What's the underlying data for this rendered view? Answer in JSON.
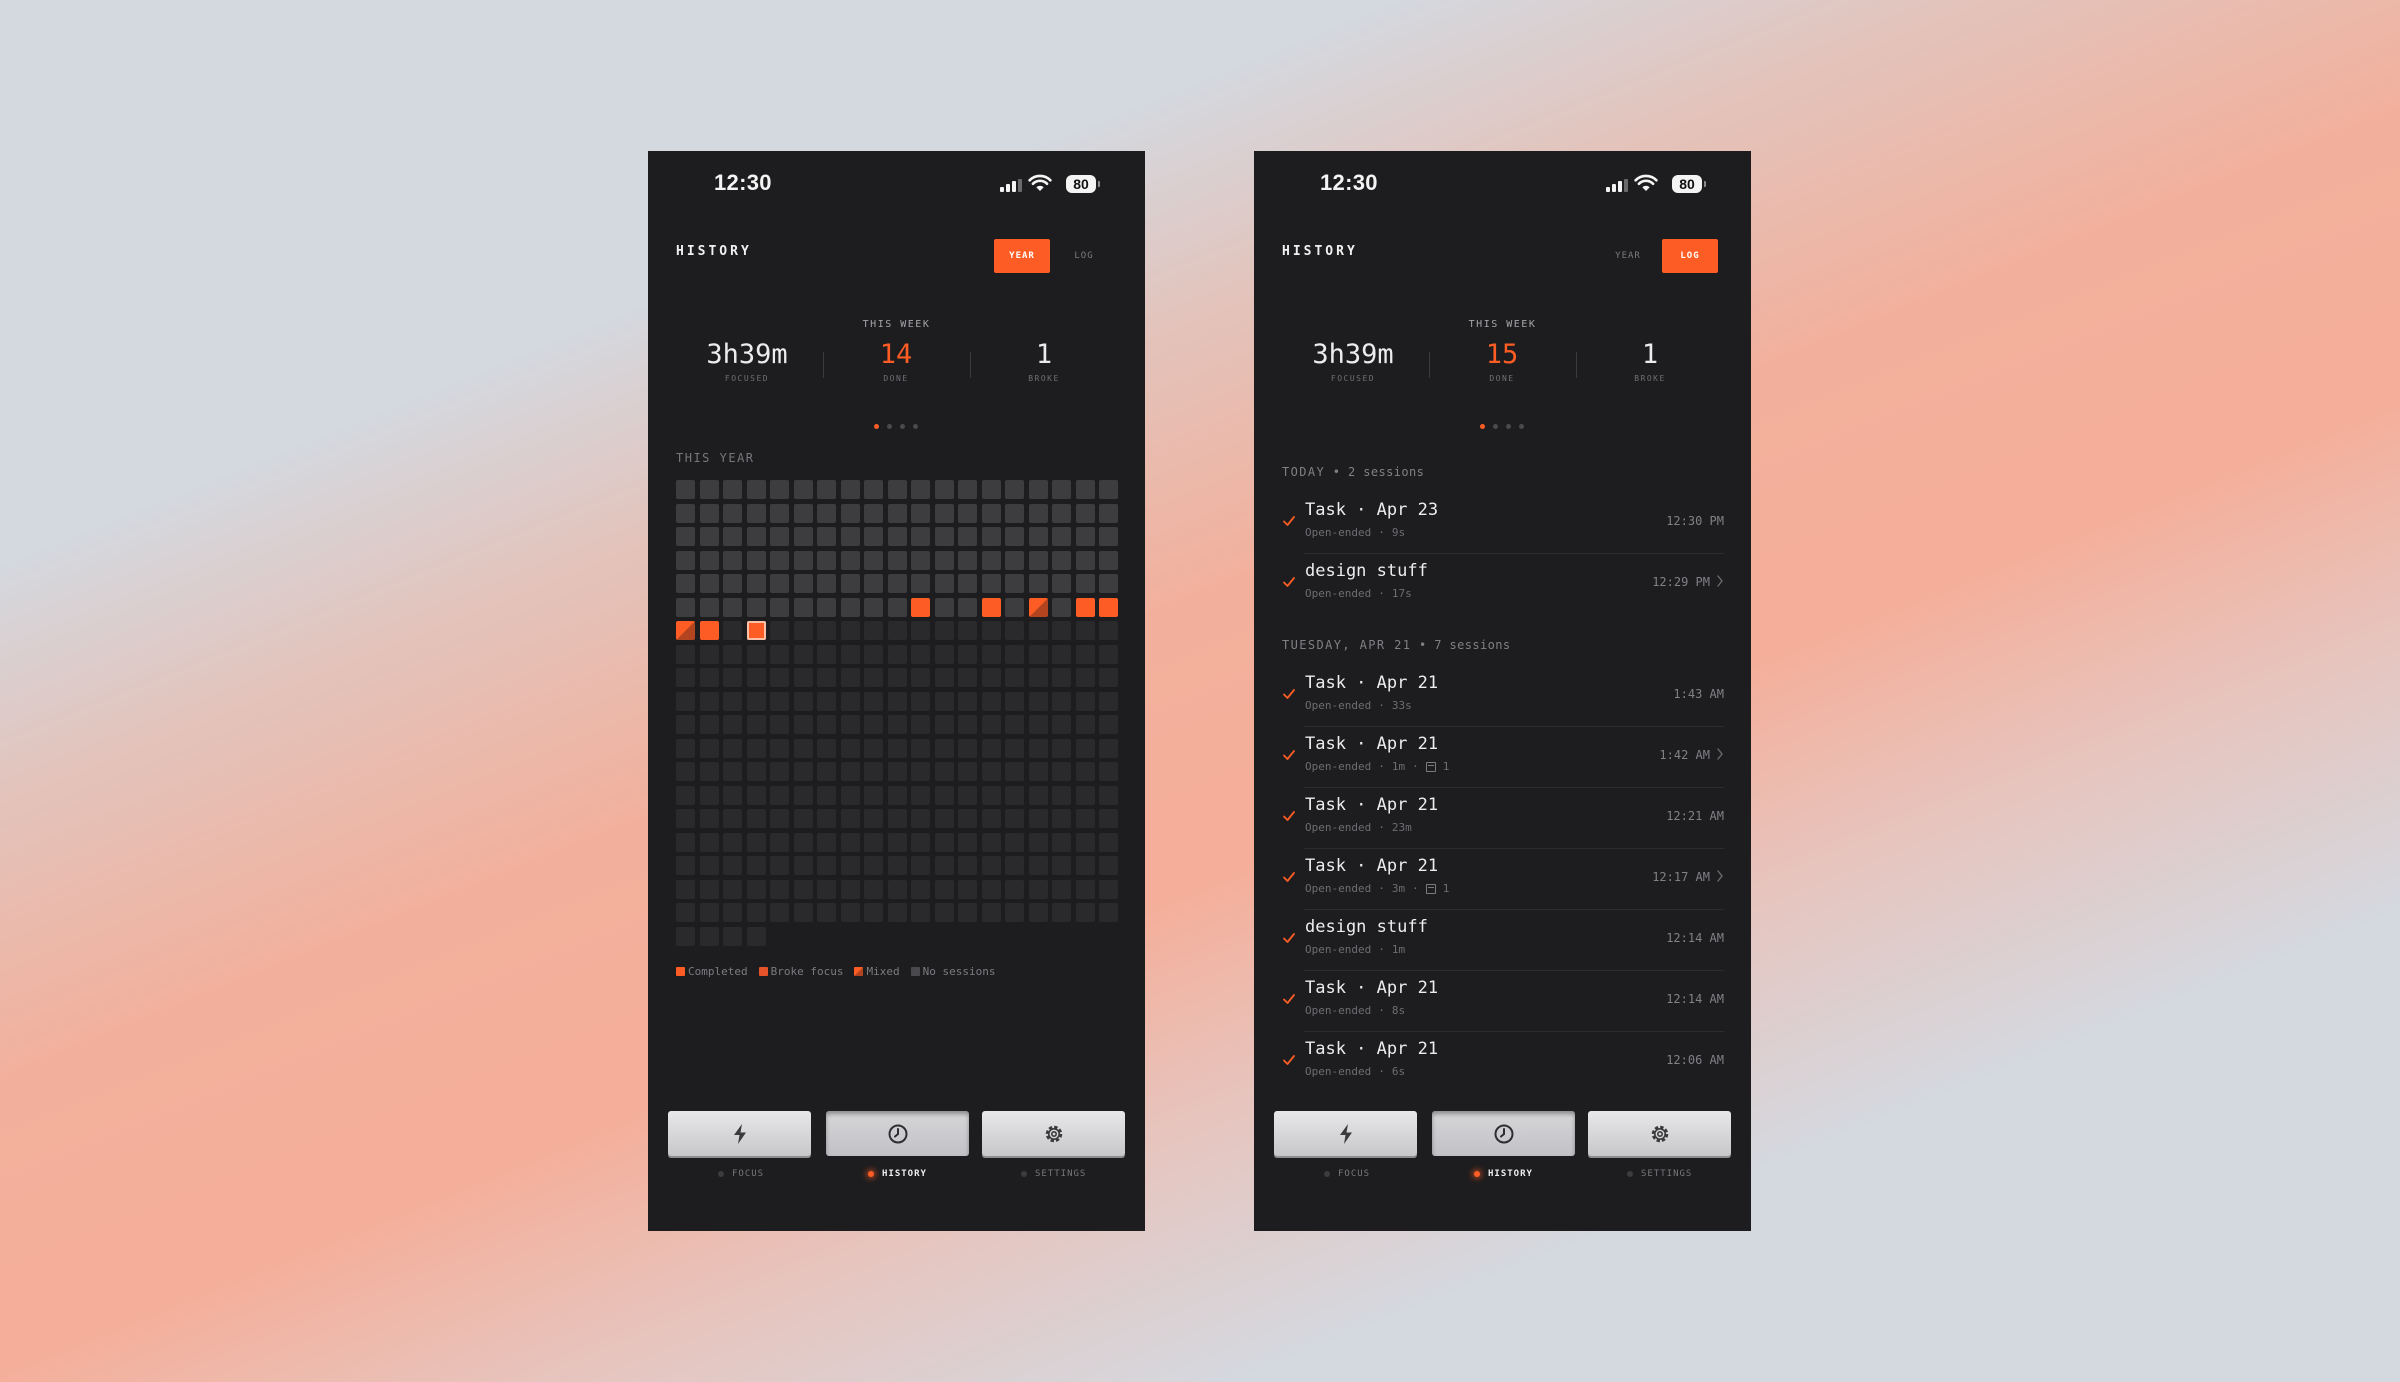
{
  "theme": {
    "accent": "#fd5d24",
    "screen_bg": "#1d1d1f"
  },
  "status": {
    "time": "12:30",
    "battery": "80"
  },
  "header": {
    "title": "HISTORY",
    "toggle_year": "YEAR",
    "toggle_log": "LOG"
  },
  "left": {
    "week_label": "THIS WEEK",
    "stats": [
      {
        "value": "3h39m",
        "label": "FOCUSED"
      },
      {
        "value": "14",
        "label": "DONE"
      },
      {
        "value": "1",
        "label": "BROKE"
      }
    ],
    "year_label": "THIS YEAR",
    "heatmap": {
      "weeks": 20,
      "days_per_week": 7,
      "total_days": 365,
      "past_days": 115,
      "completed_days": [
        105,
        108,
        112,
        113,
        115
      ],
      "mixed_days": [
        110,
        114
      ],
      "today": 117
    },
    "legend": [
      {
        "label": "Completed",
        "color": "#fd5d24"
      },
      {
        "label": "Broke focus",
        "color": "#e4532a"
      },
      {
        "label": "Mixed",
        "color": "#e65b2a"
      },
      {
        "label": "No sessions",
        "color": "#4a4a4e"
      }
    ]
  },
  "right": {
    "week_label": "THIS WEEK",
    "stats": [
      {
        "value": "3h39m",
        "label": "FOCUSED"
      },
      {
        "value": "15",
        "label": "DONE"
      },
      {
        "value": "1",
        "label": "BROKE"
      }
    ],
    "sections": [
      {
        "day": "TODAY",
        "count": " • 2 sessions"
      },
      {
        "day": "TUESDAY, APR 21",
        "count": " • 7 sessions"
      }
    ],
    "rows": [
      {
        "title": "Task · Apr 23",
        "mode": "Open-ended",
        "duration": "9s",
        "time": "12:30 PM"
      },
      {
        "title": "design stuff",
        "mode": "Open-ended",
        "duration": "17s",
        "time": "12:29 PM"
      },
      {
        "title": "Task · Apr 21",
        "mode": "Open-ended",
        "duration": "33s",
        "time": "1:43 AM"
      },
      {
        "title": "Task · Apr 21",
        "mode": "Open-ended",
        "duration": "1m",
        "notes": "1",
        "time": "1:42 AM"
      },
      {
        "title": "Task · Apr 21",
        "mode": "Open-ended",
        "duration": "23m",
        "time": "12:21 AM"
      },
      {
        "title": "Task · Apr 21",
        "mode": "Open-ended",
        "duration": "3m",
        "notes": "1",
        "time": "12:17 AM"
      },
      {
        "title": "design stuff",
        "mode": "Open-ended",
        "duration": "1m",
        "time": "12:14 AM"
      },
      {
        "title": "Task · Apr 21",
        "mode": "Open-ended",
        "duration": "8s",
        "time": "12:14 AM"
      },
      {
        "title": "Task · Apr 21",
        "mode": "Open-ended",
        "duration": "6s",
        "time": "12:06 AM"
      }
    ],
    "sep": "·"
  },
  "tabbar": {
    "focus": "FOCUS",
    "history": "HISTORY",
    "settings": "SETTINGS"
  }
}
